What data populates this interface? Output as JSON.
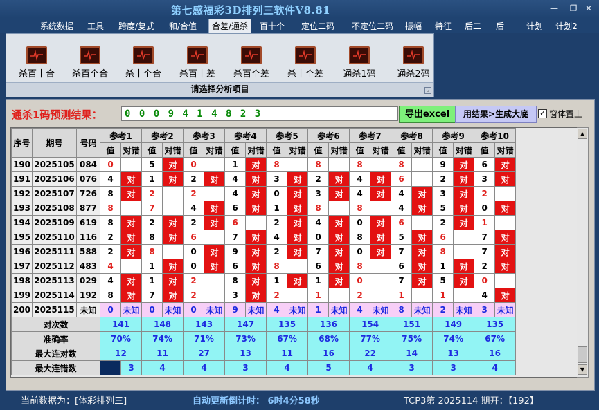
{
  "window": {
    "title": "第七感福彩3D排列三软件V8.81",
    "minimize_glyph": "—",
    "restore_glyph": "❐",
    "close_glyph": "✕"
  },
  "menu": [
    {
      "label": "系统数据",
      "active": false
    },
    {
      "label": "工具",
      "active": false
    },
    {
      "label": "跨度/复式",
      "active": false
    },
    {
      "label": "和/合值",
      "active": false
    },
    {
      "label": "合差/通杀",
      "active": true
    },
    {
      "label": "百十个",
      "active": false
    },
    {
      "label": "定位二码",
      "active": false
    },
    {
      "label": "不定位二码",
      "active": false
    },
    {
      "label": "振幅",
      "active": false
    },
    {
      "label": "特征",
      "active": false
    },
    {
      "label": "后二",
      "active": false
    },
    {
      "label": "后一",
      "active": false
    },
    {
      "label": "计划",
      "active": false
    },
    {
      "label": "计划2",
      "active": false
    }
  ],
  "ribbon": {
    "caption": "请选择分析项目",
    "tools": [
      {
        "label": "杀百十合",
        "icon": "chart-icon"
      },
      {
        "label": "杀百个合",
        "icon": "chart-icon"
      },
      {
        "label": "杀十个合",
        "icon": "chart-icon"
      },
      {
        "label": "杀百十差",
        "icon": "chart-icon"
      },
      {
        "label": "杀百个差",
        "icon": "chart-icon"
      },
      {
        "label": "杀十个差",
        "icon": "chart-icon"
      },
      {
        "label": "通杀1码",
        "icon": "chart-icon"
      },
      {
        "label": "通杀2码",
        "icon": "chart-icon"
      }
    ]
  },
  "result": {
    "label": "通杀1码预测结果：",
    "value": "0 0 0 9 4 1 4 8 2 3",
    "excel_button": "导出excel",
    "big_button": "用结果>生成大底",
    "topmost_label": "窗体置上",
    "topmost_checked": true
  },
  "table": {
    "headers": {
      "seq": "序号",
      "period": "期号",
      "code": "号码"
    },
    "groups": [
      "参考1",
      "参考2",
      "参考3",
      "参考4",
      "参考5",
      "参考6",
      "参考7",
      "参考8",
      "参考9",
      "参考10"
    ],
    "sub_value": "值",
    "sub_hit": "对错",
    "hit_text": "对",
    "rows": [
      {
        "seq": "190",
        "period": "2025105",
        "code": "084",
        "cells": [
          [
            "0",
            false
          ],
          [
            "5",
            true
          ],
          [
            "0",
            false
          ],
          [
            "1",
            true
          ],
          [
            "8",
            false
          ],
          [
            "8",
            false
          ],
          [
            "8",
            false
          ],
          [
            "8",
            false
          ],
          [
            "9",
            true
          ],
          [
            "6",
            true
          ]
        ]
      },
      {
        "seq": "191",
        "period": "2025106",
        "code": "076",
        "cells": [
          [
            "4",
            true
          ],
          [
            "1",
            true
          ],
          [
            "2",
            true
          ],
          [
            "4",
            true
          ],
          [
            "3",
            true
          ],
          [
            "2",
            true
          ],
          [
            "4",
            true
          ],
          [
            "6",
            false
          ],
          [
            "2",
            true
          ],
          [
            "3",
            true
          ]
        ]
      },
      {
        "seq": "192",
        "period": "2025107",
        "code": "726",
        "cells": [
          [
            "8",
            true
          ],
          [
            "2",
            false
          ],
          [
            "2",
            false
          ],
          [
            "4",
            true
          ],
          [
            "0",
            true
          ],
          [
            "3",
            true
          ],
          [
            "4",
            true
          ],
          [
            "4",
            true
          ],
          [
            "3",
            true
          ],
          [
            "2",
            false
          ]
        ]
      },
      {
        "seq": "193",
        "period": "2025108",
        "code": "877",
        "cells": [
          [
            "8",
            false
          ],
          [
            "7",
            false
          ],
          [
            "4",
            true
          ],
          [
            "6",
            true
          ],
          [
            "1",
            true
          ],
          [
            "8",
            false
          ],
          [
            "8",
            false
          ],
          [
            "4",
            true
          ],
          [
            "5",
            true
          ],
          [
            "0",
            true
          ]
        ]
      },
      {
        "seq": "194",
        "period": "2025109",
        "code": "619",
        "cells": [
          [
            "8",
            true
          ],
          [
            "2",
            true
          ],
          [
            "2",
            true
          ],
          [
            "6",
            false
          ],
          [
            "2",
            true
          ],
          [
            "4",
            true
          ],
          [
            "0",
            true
          ],
          [
            "6",
            false
          ],
          [
            "2",
            true
          ],
          [
            "1",
            false
          ]
        ]
      },
      {
        "seq": "195",
        "period": "2025110",
        "code": "116",
        "cells": [
          [
            "2",
            true
          ],
          [
            "8",
            true
          ],
          [
            "6",
            false
          ],
          [
            "7",
            true
          ],
          [
            "4",
            true
          ],
          [
            "0",
            true
          ],
          [
            "8",
            true
          ],
          [
            "5",
            true
          ],
          [
            "6",
            false
          ],
          [
            "7",
            true
          ]
        ]
      },
      {
        "seq": "196",
        "period": "2025111",
        "code": "588",
        "cells": [
          [
            "2",
            true
          ],
          [
            "8",
            false
          ],
          [
            "0",
            true
          ],
          [
            "9",
            true
          ],
          [
            "2",
            true
          ],
          [
            "7",
            true
          ],
          [
            "0",
            true
          ],
          [
            "7",
            true
          ],
          [
            "8",
            false
          ],
          [
            "7",
            true
          ]
        ]
      },
      {
        "seq": "197",
        "period": "2025112",
        "code": "483",
        "cells": [
          [
            "4",
            false
          ],
          [
            "1",
            true
          ],
          [
            "0",
            true
          ],
          [
            "6",
            true
          ],
          [
            "8",
            false
          ],
          [
            "6",
            true
          ],
          [
            "8",
            false
          ],
          [
            "6",
            true
          ],
          [
            "1",
            true
          ],
          [
            "2",
            true
          ]
        ]
      },
      {
        "seq": "198",
        "period": "2025113",
        "code": "029",
        "cells": [
          [
            "4",
            true
          ],
          [
            "1",
            true
          ],
          [
            "2",
            false
          ],
          [
            "8",
            true
          ],
          [
            "1",
            true
          ],
          [
            "1",
            true
          ],
          [
            "0",
            false
          ],
          [
            "7",
            true
          ],
          [
            "5",
            true
          ],
          [
            "0",
            false
          ]
        ]
      },
      {
        "seq": "199",
        "period": "2025114",
        "code": "192",
        "cells": [
          [
            "8",
            true
          ],
          [
            "7",
            true
          ],
          [
            "2",
            false
          ],
          [
            "3",
            true
          ],
          [
            "2",
            false
          ],
          [
            "1",
            false
          ],
          [
            "2",
            false
          ],
          [
            "1",
            false
          ],
          [
            "1",
            false
          ],
          [
            "4",
            true
          ]
        ]
      }
    ],
    "pending_row": {
      "seq": "200",
      "period": "2025115",
      "code": "未知",
      "unknown": "未知",
      "values": [
        "0",
        "0",
        "0",
        "9",
        "4",
        "1",
        "4",
        "8",
        "2",
        "3"
      ]
    },
    "stats": [
      {
        "label": "对次数",
        "values": [
          "141",
          "148",
          "143",
          "147",
          "135",
          "136",
          "154",
          "151",
          "149",
          "135"
        ]
      },
      {
        "label": "准确率",
        "values": [
          "70%",
          "74%",
          "71%",
          "73%",
          "67%",
          "68%",
          "77%",
          "75%",
          "74%",
          "67%"
        ]
      },
      {
        "label": "最大连对数",
        "values": [
          "12",
          "11",
          "27",
          "13",
          "11",
          "16",
          "22",
          "14",
          "13",
          "16"
        ]
      },
      {
        "label": "最大连错数",
        "values": [
          "3",
          "4",
          "4",
          "3",
          "4",
          "5",
          "4",
          "3",
          "3",
          "4"
        ]
      }
    ]
  },
  "status": {
    "source": "当前数据为：[体彩排列三]",
    "countdown": "自动更新倒计时：  6时4分58秒",
    "open_info": "TCP3第 2025114 期开：【192】"
  }
}
